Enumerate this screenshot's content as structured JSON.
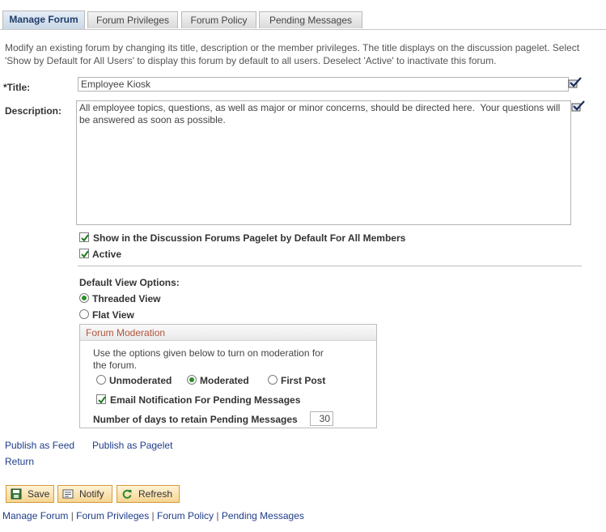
{
  "tabs": [
    {
      "label": "Manage Forum",
      "active": true
    },
    {
      "label": "Forum Privileges",
      "active": false
    },
    {
      "label": "Forum Policy",
      "active": false
    },
    {
      "label": "Pending Messages",
      "active": false
    }
  ],
  "intro": "Modify an existing forum by changing its title, description or the member privileges. The title displays on the discussion pagelet. Select 'Show by Default for All Users' to display this forum by default to all users. Deselect 'Active' to inactivate this forum.",
  "form": {
    "title_label": "*Title:",
    "title_value": "Employee Kiosk",
    "description_label": "Description:",
    "description_value": "All employee topics, questions, as well as major or minor concerns, should be directed here.  Your questions will be answered as soon as possible.",
    "show_default_label": "Show in the Discussion Forums Pagelet by Default For All Members",
    "show_default_checked": true,
    "active_label": "Active",
    "active_checked": true
  },
  "view_options": {
    "label": "Default View Options:",
    "threaded": "Threaded View",
    "flat": "Flat View",
    "selected": "threaded"
  },
  "moderation": {
    "title": "Forum Moderation",
    "hint": "Use the options given below to turn on moderation for the forum.",
    "unmoderated": "Unmoderated",
    "moderated": "Moderated",
    "first_post": "First Post",
    "selected": "moderated",
    "email_label": "Email Notification For Pending Messages",
    "email_checked": true,
    "retain_label": "Number of days to retain Pending Messages",
    "retain_value": "30"
  },
  "links": {
    "publish_feed": "Publish as Feed",
    "publish_pagelet": "Publish as Pagelet",
    "return": "Return"
  },
  "buttons": {
    "save": "Save",
    "notify": "Notify",
    "refresh": "Refresh"
  },
  "footer": {
    "manage": "Manage Forum",
    "privileges": "Forum Privileges",
    "policy": "Forum Policy",
    "pending": "Pending Messages",
    "separator": " | "
  },
  "colors": {
    "accent_link": "#1f3c8a",
    "moderation_title": "#b2543a",
    "button_fill": "#f6d592",
    "radio_selected": "#2a8f2a"
  },
  "icons": {
    "spell_check": "spell-check-icon",
    "save": "save-icon",
    "notify": "notify-icon",
    "refresh": "refresh-icon"
  }
}
